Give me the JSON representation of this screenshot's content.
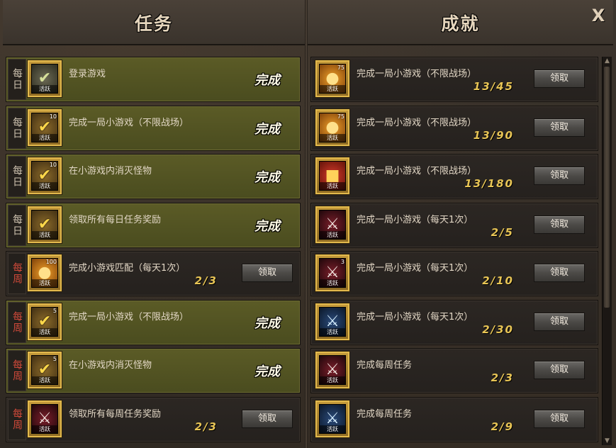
{
  "header": {
    "tasks_title": "任务",
    "achievements_title": "成就",
    "close_label": "X"
  },
  "tasks": [
    {
      "type": "每日",
      "kind": "daily",
      "title": "登录游戏",
      "status": "done",
      "status_label": "完成",
      "icon": "login",
      "icon_label": "活跃",
      "icon_count": ""
    },
    {
      "type": "每日",
      "kind": "daily",
      "title": "完成一局小游戏（不限战场）",
      "status": "done",
      "status_label": "完成",
      "icon": "check",
      "icon_label": "活跃",
      "icon_count": "10"
    },
    {
      "type": "每日",
      "kind": "daily",
      "title": "在小游戏内消灭怪物",
      "status": "done",
      "status_label": "完成",
      "icon": "check",
      "icon_label": "活跃",
      "icon_count": "10"
    },
    {
      "type": "每日",
      "kind": "daily",
      "title": "领取所有每日任务奖励",
      "status": "done",
      "status_label": "完成",
      "icon": "check",
      "icon_label": "活跃",
      "icon_count": ""
    },
    {
      "type": "每周",
      "kind": "weekly",
      "title": "完成小游戏匹配（每天1次）",
      "status": "progress",
      "progress": "2/3",
      "button_label": "领取",
      "icon": "coin",
      "icon_label": "活跃",
      "icon_count": "100"
    },
    {
      "type": "每周",
      "kind": "weekly",
      "title": "完成一局小游戏（不限战场）",
      "status": "done",
      "status_label": "完成",
      "icon": "check",
      "icon_label": "活跃",
      "icon_count": "5"
    },
    {
      "type": "每周",
      "kind": "weekly",
      "title": "在小游戏内消灭怪物",
      "status": "done",
      "status_label": "完成",
      "icon": "check",
      "icon_label": "活跃",
      "icon_count": "5"
    },
    {
      "type": "每周",
      "kind": "weekly",
      "title": "领取所有每周任务奖励",
      "status": "progress",
      "progress": "2/3",
      "button_label": "领取",
      "icon": "sword",
      "icon_label": "活跃",
      "icon_count": ""
    }
  ],
  "achievements": [
    {
      "title": "完成一局小游戏（不限战场）",
      "progress": "13/45",
      "button_label": "领取",
      "icon": "coin",
      "icon_label": "活跃",
      "icon_count": "75"
    },
    {
      "title": "完成一局小游戏（不限战场）",
      "progress": "13/90",
      "button_label": "领取",
      "icon": "coin",
      "icon_label": "活跃",
      "icon_count": "75"
    },
    {
      "title": "完成一局小游戏（不限战场）",
      "progress": "13/180",
      "button_label": "领取",
      "icon": "gift",
      "icon_label": "活跃",
      "icon_count": ""
    },
    {
      "title": "完成一局小游戏（每天1次）",
      "progress": "2/5",
      "button_label": "领取",
      "icon": "sword",
      "icon_label": "活跃",
      "icon_count": ""
    },
    {
      "title": "完成一局小游戏（每天1次）",
      "progress": "2/10",
      "button_label": "领取",
      "icon": "sword",
      "icon_label": "活跃",
      "icon_count": "3"
    },
    {
      "title": "完成一局小游戏（每天1次）",
      "progress": "2/30",
      "button_label": "领取",
      "icon": "blade",
      "icon_label": "活跃",
      "icon_count": ""
    },
    {
      "title": "完成每周任务",
      "progress": "2/3",
      "button_label": "领取",
      "icon": "sword",
      "icon_label": "活跃",
      "icon_count": ""
    },
    {
      "title": "完成每周任务",
      "progress": "2/9",
      "button_label": "领取",
      "icon": "blade",
      "icon_label": "活跃",
      "icon_count": ""
    }
  ],
  "icon_glyphs": {
    "login": "✔",
    "check": "✔",
    "coin": "●",
    "gift": "■",
    "sword": "⚔",
    "blade": "⚔"
  },
  "colors": {
    "done_row": "#5b5b26",
    "weekly_tag": "#d24a3a",
    "progress_text": "#e7c455",
    "icon_frame": "#c69b3b"
  }
}
